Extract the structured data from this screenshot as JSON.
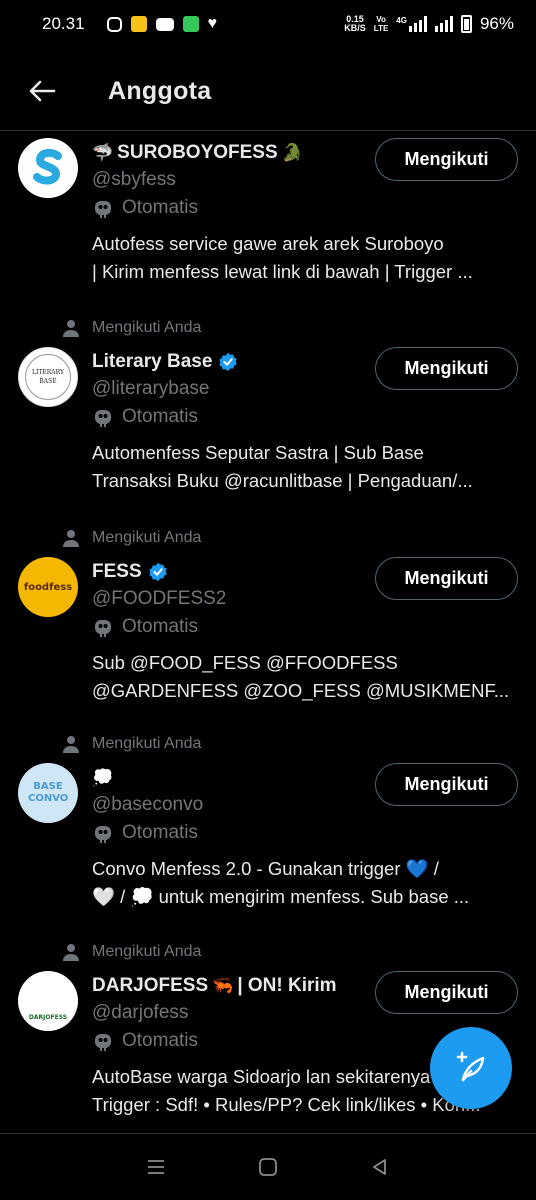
{
  "status_bar": {
    "time": "20.31",
    "net_speed_value": "0.15",
    "net_speed_unit": "KB/S",
    "volte_top": "Vo",
    "volte_bottom": "LTE",
    "network_type": "4G",
    "battery": "96%"
  },
  "header": {
    "title": "Anggota"
  },
  "members": [
    {
      "follows_you": "",
      "name": "SUROBOYOFESS",
      "name_prefix_emoji": "🦈",
      "name_suffix_emoji": "🐊",
      "name_extra": "",
      "verified": false,
      "handle": "@sbyfess",
      "automated": "Otomatis",
      "bio_line1": "Autofess service gawe arek arek Suroboyo",
      "bio_line2": "| Kirim menfess lewat link di bawah | Trigger ...",
      "follow_label": "Mengikuti",
      "avatar_bg": "#ffffff",
      "avatar_text": ""
    },
    {
      "follows_you": "Mengikuti Anda",
      "name": "Literary Base",
      "name_prefix_emoji": "",
      "name_suffix_emoji": "",
      "name_extra": "",
      "verified": true,
      "handle": "@literarybase",
      "automated": "Otomatis",
      "bio_line1": "Automenfess Seputar Sastra | Sub Base",
      "bio_line2": "Transaksi Buku @racunlitbase | Pengaduan/...",
      "follow_label": "Mengikuti",
      "avatar_bg": "#ffffff",
      "avatar_text": "LITERARY BASE"
    },
    {
      "follows_you": "Mengikuti Anda",
      "name": "FESS",
      "name_prefix_emoji": "",
      "name_suffix_emoji": "",
      "name_extra": "",
      "verified": true,
      "handle": "@FOODFESS2",
      "automated": "Otomatis",
      "bio_line1": "Sub @FOOD_FESS @FFOODFESS",
      "bio_line2": "@GARDENFESS @ZOO_FESS @MUSIKMENF...",
      "follow_label": "Mengikuti",
      "avatar_bg": "#f5b800",
      "avatar_text": "foodfess"
    },
    {
      "follows_you": "Mengikuti Anda",
      "name": "💭",
      "name_prefix_emoji": "",
      "name_suffix_emoji": "",
      "name_extra": "",
      "verified": false,
      "handle": "@baseconvo",
      "automated": "Otomatis",
      "bio_line1": "Convo Menfess 2.0 - Gunakan trigger 💙 /",
      "bio_line2": "🤍 / 💭 untuk mengirim menfess. Sub base ...",
      "follow_label": "Mengikuti",
      "avatar_bg": "#cfe6f7",
      "avatar_text": "BASE CONVO"
    },
    {
      "follows_you": "Mengikuti Anda",
      "name": "DARJOFESS",
      "name_prefix_emoji": "",
      "name_suffix_emoji": "🦐",
      "name_extra": "| ON! Kirim",
      "verified": false,
      "handle": "@darjofess",
      "automated": "Otomatis",
      "bio_line1": "AutoBase warga Sidoarjo lan sekitarenya",
      "bio_line2": "Trigger : Sdf! • Rules/PP? Cek link/likes • Kon...",
      "follow_label": "Mengikuti",
      "avatar_bg": "#ffffff",
      "avatar_text": "DARJOFESS"
    }
  ],
  "colors": {
    "background": "#000000",
    "text_primary": "#e7e9ea",
    "text_secondary": "#71767b",
    "accent": "#1d9bf0",
    "border": "#536471"
  }
}
